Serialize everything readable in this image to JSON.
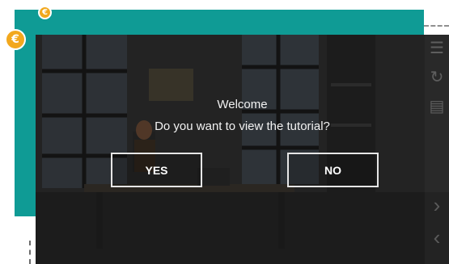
{
  "dialog": {
    "title": "Welcome",
    "question": "Do you want to view the tutorial?",
    "yes_label": "YES",
    "no_label": "NO"
  },
  "badges": {
    "small": "€",
    "large": "€"
  },
  "colors": {
    "teal_panel": "#0f9b95",
    "badge": "#f2a81d"
  },
  "icons": {
    "side": [
      "menu-icon",
      "refresh-icon",
      "comment-icon",
      "chevron-right-icon",
      "chevron-left-icon"
    ]
  }
}
